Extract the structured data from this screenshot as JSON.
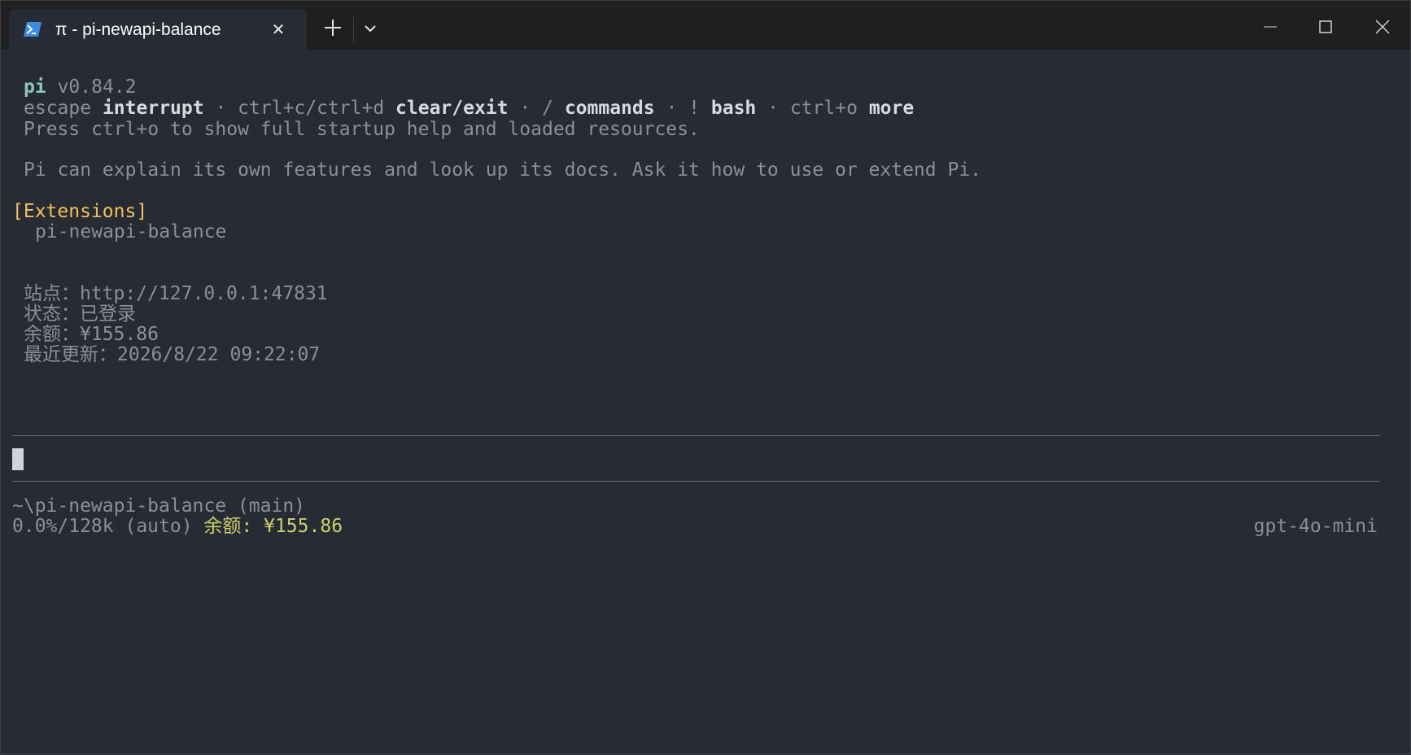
{
  "window": {
    "tab_title": "π - pi-newapi-balance",
    "tab_icon": "powershell-icon",
    "controls": [
      "minimize-icon",
      "maximize-icon",
      "close-icon"
    ]
  },
  "terminal": {
    "header": {
      "name": "pi",
      "version": "v0.84.2",
      "keys": [
        {
          "key": "escape",
          "action": "interrupt"
        },
        {
          "key": "ctrl+c/ctrl+d",
          "action": "clear/exit"
        },
        {
          "key": "/",
          "action": "commands"
        },
        {
          "key": "!",
          "action": "bash"
        },
        {
          "key": "ctrl+o",
          "action": "more"
        }
      ],
      "separator": "·",
      "help_line": "Press ctrl+o to show full startup help and loaded resources.",
      "explain_line": "Pi can explain its own features and look up its docs. Ask it how to use or extend Pi."
    },
    "extensions": {
      "heading": "[Extensions]",
      "items": [
        "pi-newapi-balance"
      ]
    },
    "status": [
      {
        "label": "站点：",
        "value": "http://127.0.0.1:47831"
      },
      {
        "label": "状态：",
        "value": "已登录"
      },
      {
        "label": "余额：",
        "value": "¥155.86"
      },
      {
        "label": "最近更新：",
        "value": "2026/8/22 09:22:07"
      }
    ],
    "footer": {
      "cwd": "~\\pi-newapi-balance (main)",
      "context": "0.0%/128k (auto)",
      "balance": "余额: ¥155.86",
      "model": "gpt-4o-mini"
    },
    "colors": {
      "background": "#272b33",
      "dim_text": "#8b8f96",
      "bright_text": "#d6d9de",
      "accent": "#8cc7c4",
      "extensions": "#f2c15a",
      "balance": "#cdd16a"
    }
  }
}
